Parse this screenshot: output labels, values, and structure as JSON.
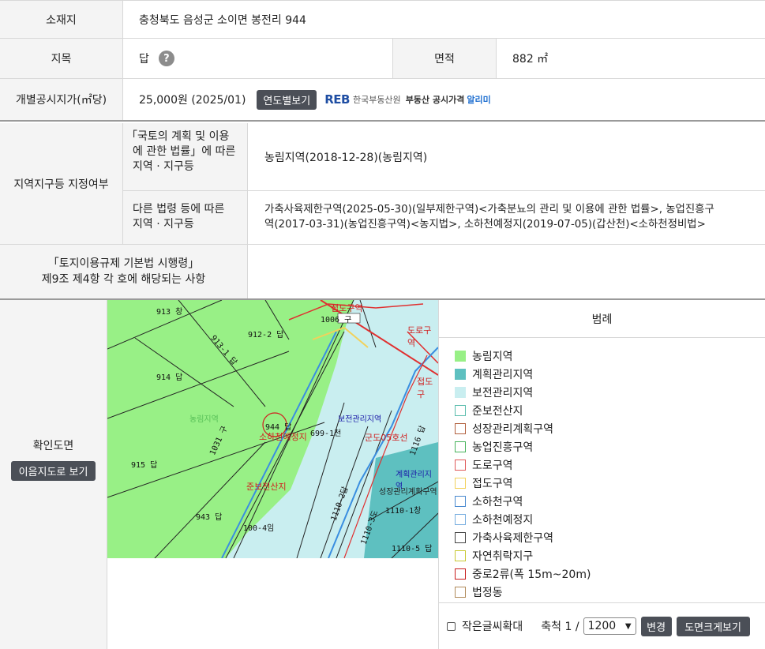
{
  "info": {
    "location_label": "소재지",
    "location_value": "충청북도 음성군 소이면 봉전리 944",
    "jimok_label": "지목",
    "jimok_value": "답",
    "area_label": "면적",
    "area_value": "882 ㎡",
    "price_label": "개별공시지가(㎡당)",
    "price_value": "25,000원 (2025/01)",
    "yearly_button": "연도별보기",
    "reb": {
      "logo": "REB",
      "org": "한국부동산원",
      "service": "부동산 공시가격",
      "alert": "알리미"
    }
  },
  "zoning": {
    "section_label": "지역지구등 지정여부",
    "law1_label_line1": "「국토의 계획 및 이용",
    "law1_label_line2": "에 관한 법률」에 따른",
    "law1_label_line3": "지역 · 지구등",
    "law1_value": "농림지역(2018-12-28)(농림지역)",
    "law2_label_line1": "다른 법령 등에 따른",
    "law2_label_line2": "지역 · 지구등",
    "law2_value_line1": "가축사육제한구역(2025-05-30)(일부제한구역)<가축분뇨의 관리 및 이용에 관한 법률>, 농업진흥구",
    "law2_value_line2": "역(2017-03-31)(농업진흥구역)<농지법>, 소하천예정지(2019-07-05)(갑산천)<소하천정비법>",
    "decree_label_line1": "「토지이용규제 기본법 시행령」",
    "decree_label_line2": "제9조 제4항 각 호에 해당되는 사항",
    "decree_value": ""
  },
  "mapsection": {
    "label": "확인도면",
    "view_button": "이음지도로 보기",
    "map_labels": {
      "l913": "913 창",
      "l1006": "1006 구",
      "l9122": "912-2 답",
      "l9131": "913-1 답",
      "l914": "914 답",
      "l944": "944 답",
      "l6991": "699-1천",
      "l1031": "1031 구",
      "l915": "915 답",
      "l943": "943 답",
      "l1004": "100-4임",
      "l11101": "1110-1창",
      "l11105": "1110-5 답",
      "l1116": "1116 답",
      "l11102": "1110-2답",
      "l11103": "1110-3도"
    },
    "map_zone_labels": {
      "jubdo": "접도구역",
      "road": "도로구역",
      "jubdo2": "접도구",
      "sohacheon_yejeong": "소하천예정지",
      "bojeon": "보전관리지역",
      "gundo": "군도05호선",
      "nonglim": "농림지역",
      "jun_bojeon": "준보전산지",
      "gyehoek": "계획관리지역",
      "seongjang": "성장관리계획구역"
    },
    "legend_title": "범례",
    "legend": [
      {
        "label": "농림지역",
        "color": "#98f086",
        "filled": true
      },
      {
        "label": "계획관리지역",
        "color": "#5ec0c0",
        "filled": true
      },
      {
        "label": "보전관리지역",
        "color": "#c9eef0",
        "filled": true
      },
      {
        "label": "준보전산지",
        "color": "#5bbdad",
        "filled": false
      },
      {
        "label": "성장관리계획구역",
        "color": "#b2603e",
        "filled": false
      },
      {
        "label": "농업진흥구역",
        "color": "#47b35b",
        "filled": false
      },
      {
        "label": "도로구역",
        "color": "#e05a5a",
        "filled": false
      },
      {
        "label": "접도구역",
        "color": "#f2d15b",
        "filled": false
      },
      {
        "label": "소하천구역",
        "color": "#4a8ad0",
        "filled": false
      },
      {
        "label": "소하천예정지",
        "color": "#78aee0",
        "filled": false
      },
      {
        "label": "가축사육제한구역",
        "color": "#444444",
        "filled": false
      },
      {
        "label": "자연취락지구",
        "color": "#c8c832",
        "filled": false
      },
      {
        "label": "중로2류(폭 15m~20m)",
        "color": "#c81e1e",
        "filled": false
      },
      {
        "label": "법정동",
        "color": "#b08a5a",
        "filled": false
      }
    ],
    "small_text_label": "작은글씨확대",
    "scale_label": "축척 1 /",
    "scale_value": "1200",
    "change_button": "변경",
    "large_view_button": "도면크게보기"
  }
}
